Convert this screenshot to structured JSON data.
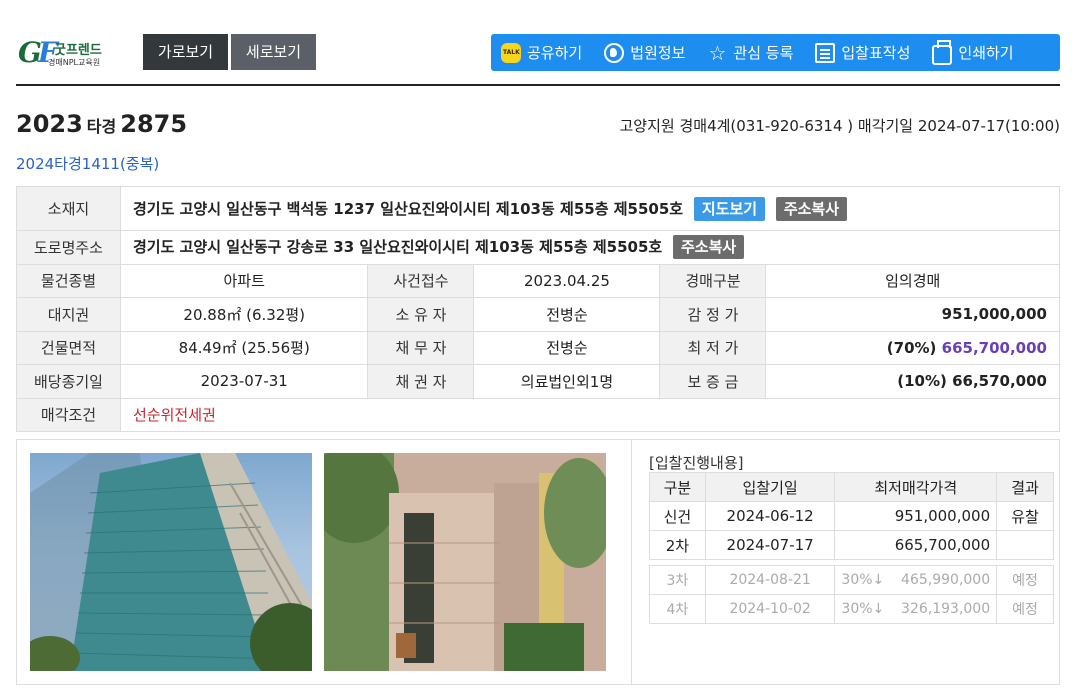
{
  "brand": {
    "mark": "GF",
    "name": "굿프렌드",
    "sub": "경매NPL교육원"
  },
  "view": {
    "horizontal": "가로보기",
    "vertical": "세로보기"
  },
  "actions": {
    "share": "공유하기",
    "court": "법원정보",
    "favorite": "관심 등록",
    "bid_form": "입찰표작성",
    "print": "인쇄하기"
  },
  "case": {
    "year": "2023",
    "type": "타경",
    "number": "2875",
    "court_info": "고양지원 경매4계(031-920-6314 ) 매각기일 2024-07-17(10:00)",
    "duplicate": "2024타경1411(중복)"
  },
  "info": {
    "location_label": "소재지",
    "location": "경기도 고양시 일산동구 백석동 1237 일산요진와이시티 제103동 제55층 제5505호",
    "map_btn": "지도보기",
    "copy_btn": "주소복사",
    "road_label": "도로명주소",
    "road": "경기도 고양시 일산동구 강송로 33 일산요진와이시티 제103동 제55층 제5505호",
    "row1": {
      "l1": "물건종별",
      "v1": "아파트",
      "l2": "사건접수",
      "v2": "2023.04.25",
      "l3": "경매구분",
      "v3": "임의경매"
    },
    "row2": {
      "l1": "대지권",
      "v1": "20.88㎡ (6.32평)",
      "l2": "소 유 자",
      "v2": "전병순",
      "l3": "감 정 가",
      "v3": "951,000,000"
    },
    "row3": {
      "l1": "건물면적",
      "v1": "84.49㎡ (25.56평)",
      "l2": "채 무 자",
      "v2": "전병순",
      "l3": "최 저 가",
      "v3_pct": "(70%)",
      "v3": "665,700,000"
    },
    "row4": {
      "l1": "배당종기일",
      "v1": "2023-07-31",
      "l2": "채 권 자",
      "v2": "의료법인외1명",
      "l3": "보 증 금",
      "v3_pct": "(10%)",
      "v3": "66,570,000"
    },
    "cond_label": "매각조건",
    "cond": "선순위전세권"
  },
  "bid": {
    "title": "[입찰진행내용]",
    "headers": [
      "구분",
      "입찰기일",
      "최저매각가격",
      "결과"
    ],
    "rows": [
      {
        "round": "신건",
        "date": "2024-06-12",
        "price": "951,000,000",
        "result": "유찰"
      },
      {
        "round": "2차",
        "date": "2024-07-17",
        "price": "665,700,000",
        "result": ""
      }
    ],
    "future": [
      {
        "round": "3차",
        "date": "2024-08-21",
        "pct": "30%↓",
        "price": "465,990,000",
        "result": "예정"
      },
      {
        "round": "4차",
        "date": "2024-10-02",
        "pct": "30%↓",
        "price": "326,193,000",
        "result": "예정"
      }
    ]
  }
}
